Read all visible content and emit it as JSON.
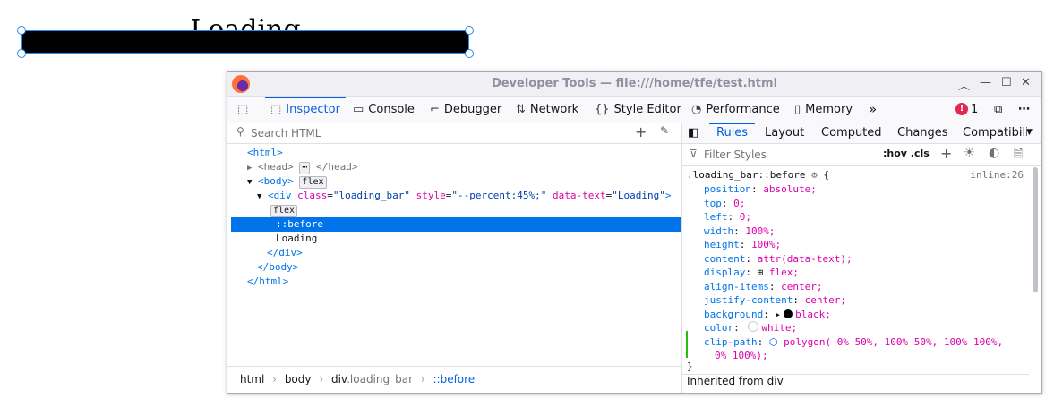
{
  "page": {
    "loading_text": "Loading"
  },
  "devtools": {
    "title": "Developer Tools — file:///home/tfe/test.html",
    "toolbar": {
      "inspector": "Inspector",
      "console": "Console",
      "debugger": "Debugger",
      "network": "Network",
      "style_editor": "Style Editor",
      "performance": "Performance",
      "memory": "Memory",
      "error_count": "1"
    },
    "search_placeholder": "Search HTML",
    "tree": {
      "html_open": "<html>",
      "head": "<head>",
      "head_close": "</head>",
      "body_open": "<body>",
      "flex_badge": "flex",
      "div_tag": "<div",
      "attr_class": "class",
      "class_value": "\"loading_bar\"",
      "attr_style": "style",
      "style_value": "\"--percent:45%;\"",
      "attr_datatext": "data-text",
      "datatext_value": "\"Loading\"",
      "div_gt": ">",
      "before": "::before",
      "text_node": "Loading",
      "div_close": "</div>",
      "body_close": "</body>",
      "html_close": "</html>",
      "ellipsis": "⋯"
    },
    "breadcrumbs": {
      "html": "html",
      "body": "body",
      "div": "div",
      "div_class": ".loading_bar",
      "before": "::before"
    },
    "rule_tabs": {
      "rules": "Rules",
      "layout": "Layout",
      "computed": "Computed",
      "changes": "Changes",
      "compat": "Compatibili"
    },
    "filter_placeholder": "Filter Styles",
    "hov_cls": ":hov .cls",
    "rule": {
      "selector": ".loading_bar::before",
      "source": "inline:26",
      "open_brace": "{",
      "close_brace": "}",
      "inherited": "Inherited from div",
      "decls": [
        {
          "p": "position",
          "v": "absolute;"
        },
        {
          "p": "top",
          "v": "0;"
        },
        {
          "p": "left",
          "v": "0;"
        },
        {
          "p": "width",
          "v": "100%;"
        },
        {
          "p": "height",
          "v": "100%;"
        },
        {
          "p": "content",
          "v": "attr(data-text);"
        },
        {
          "p": "display",
          "v": "flex;"
        },
        {
          "p": "align-items",
          "v": "center;"
        },
        {
          "p": "justify-content",
          "v": "center;"
        },
        {
          "p": "background",
          "v": "black;"
        },
        {
          "p": "color",
          "v": "white;"
        },
        {
          "p": "clip-path",
          "v": "polygon( 0% 50%, 100% 50%, 100% 100%,"
        },
        {
          "p": "",
          "v": "0% 100%);"
        }
      ]
    }
  },
  "colors": {
    "accent": "#0060df",
    "selection": "#0074e8",
    "error": "#e22850",
    "changed": "#2cbb0f"
  }
}
